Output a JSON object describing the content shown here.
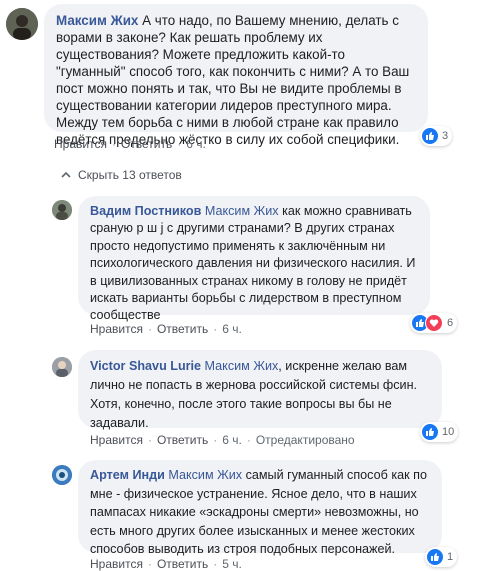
{
  "comments": [
    {
      "author": "Максим Жих",
      "text": "А что надо, по Вашему мнению, делать с ворами в законе? Как решать проблему их существования? Можете предложить какой-то \"гуманный\" способ того, как покончить с ними? А то Ваш пост можно понять и так, что Вы не видите проблемы в существовании категории лидеров преступного мира. Между тем борьба с ними в любой стране как правило ведётся предельно жёстко в силу их собой специфики.",
      "like": "Нравится",
      "reply": "Ответить",
      "time": "6 ч.",
      "reactions_count": "3"
    }
  ],
  "replies_toggle": "Скрыть 13 ответов",
  "replies": [
    {
      "author": "Вадим Постников",
      "mention": "Максим Жих",
      "text": " как можно сравнивать сраную р ш ј с другими странами? В других странах просто недопустимо применять к заключённым ни психологического давления ни физического насилия. И в цивилизованных странах никому в голову не придёт искать варианты борьбы с лидерством в преступном сообществе",
      "like": "Нравится",
      "reply": "Ответить",
      "time": "6 ч.",
      "reactions_count": "6"
    },
    {
      "author": "Victor Shavu Lurie",
      "mention": "Максим Жих",
      "text": ", искренне желаю вам лично не попасть в жернова российской системы фсин. Хотя, конечно, после этого такие вопросы вы бы не задавали.",
      "like": "Нравится",
      "reply": "Ответить",
      "time": "6 ч.",
      "edited": "Отредактировано",
      "reactions_count": "10"
    },
    {
      "author": "Артем Инди",
      "mention": "Максим Жих",
      "text": " самый гуманный способ как по мне - физическое устранение. Ясное дело, что в наших пампасах никакие «эскадроны смерти» невозможны, но есть много других более изысканных и менее жестоких способов выводить из строя подобных персонажей.",
      "like": "Нравится",
      "reply": "Ответить",
      "time": "5 ч.",
      "reactions_count": "1"
    }
  ],
  "colors": {
    "link": "#385898",
    "bubble": "#f0f2f5",
    "like_blue": "#1877f2",
    "love_red": "#f33e58"
  }
}
